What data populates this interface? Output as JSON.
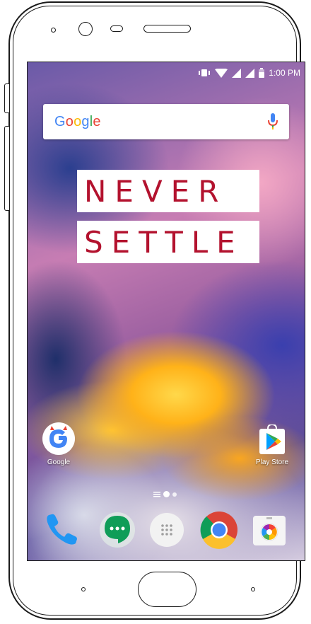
{
  "status_bar": {
    "time": "1:00 PM"
  },
  "search": {
    "logo_letters": [
      "G",
      "o",
      "o",
      "g",
      "l",
      "e"
    ]
  },
  "banner": {
    "line1": "NEVER",
    "line2": "SETTLE"
  },
  "apps": {
    "google": {
      "label": "Google",
      "icon": "google-icon"
    },
    "play_store": {
      "label": "Play Store",
      "icon": "play-store-icon"
    }
  },
  "dock": [
    {
      "name": "phone",
      "icon": "phone-icon"
    },
    {
      "name": "hangouts",
      "icon": "hangouts-icon"
    },
    {
      "name": "app-drawer",
      "icon": "app-drawer-icon"
    },
    {
      "name": "chrome",
      "icon": "chrome-icon"
    },
    {
      "name": "camera",
      "icon": "camera-icon"
    }
  ],
  "colors": {
    "banner_text": "#b3122e",
    "google_blue": "#4285f4",
    "google_red": "#ea4335",
    "google_yellow": "#fbbc05",
    "google_green": "#34a853"
  }
}
